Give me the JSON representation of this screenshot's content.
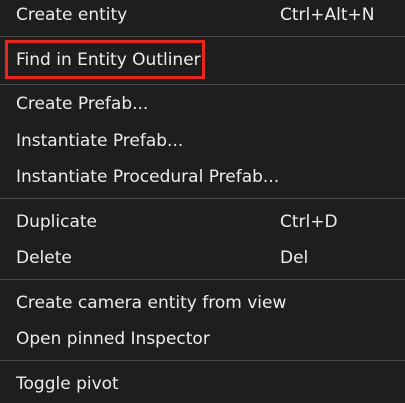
{
  "menu": {
    "items": [
      {
        "label": "Create entity",
        "shortcut": "Ctrl+Alt+N"
      },
      {
        "label": "Find in Entity Outliner",
        "shortcut": ""
      },
      {
        "label": "Create Prefab...",
        "shortcut": ""
      },
      {
        "label": "Instantiate Prefab...",
        "shortcut": ""
      },
      {
        "label": "Instantiate Procedural Prefab...",
        "shortcut": ""
      },
      {
        "label": "Duplicate",
        "shortcut": "Ctrl+D"
      },
      {
        "label": "Delete",
        "shortcut": "Del"
      },
      {
        "label": "Create camera entity from view",
        "shortcut": ""
      },
      {
        "label": "Open pinned Inspector",
        "shortcut": ""
      },
      {
        "label": "Toggle pivot",
        "shortcut": ""
      }
    ]
  },
  "highlight": {
    "color": "#e8261e",
    "target": "Find in Entity Outliner"
  },
  "colors": {
    "background": "#1e1e1e",
    "text": "#ededed",
    "separator": "#4a4a4a"
  }
}
